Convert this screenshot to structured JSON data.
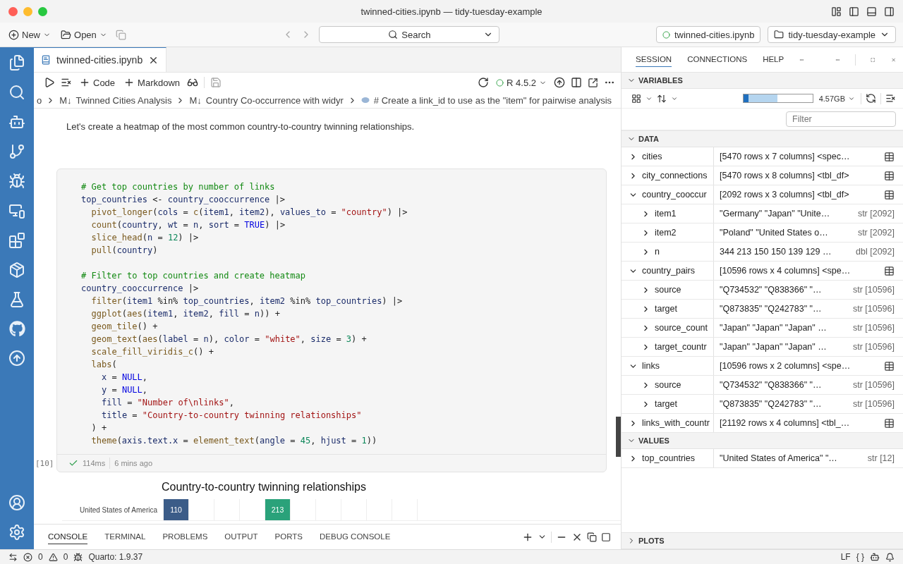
{
  "window": {
    "title": "twinned-cities.ipynb — tidy-tuesday-example"
  },
  "toolbar": {
    "new_label": "New",
    "open_label": "Open",
    "search_label": "Search",
    "file_pill": "twinned-cities.ipynb",
    "folder_pill": "tidy-tuesday-example"
  },
  "editor_tabs": [
    {
      "label": "twinned-cities.ipynb",
      "selected": true
    }
  ],
  "notebook_toolbar": {
    "code_label": "Code",
    "markdown_label": "Markdown",
    "kernel": "R 4.5.2"
  },
  "breadcrumbs": [
    {
      "kind": "plain",
      "text": "o"
    },
    {
      "kind": "markdown",
      "marker": "M↓",
      "text": "Twinned Cities Analysis"
    },
    {
      "kind": "markdown",
      "marker": "M↓",
      "text": "Country Co-occurrence with widyr"
    },
    {
      "kind": "code",
      "text": "# Create a link_id to use as the \"item\" for pairwise analysis"
    }
  ],
  "markdown_text": "Let's create a heatmap of the most common country-to-country twinning relationships.",
  "code_cell": {
    "execution_count": "[10]",
    "success": true,
    "duration": "114ms",
    "ago": "6 mins ago",
    "lines": [
      {
        "kind": "root",
        "tokens": [
          {
            "kind": "comment",
            "text": "# Get top countries by number of links"
          }
        ]
      },
      {
        "kind": "root",
        "tokens": [
          {
            "kind": "var",
            "text": "top_countries"
          },
          {
            "kind": "op",
            "text": " <- "
          },
          {
            "kind": "var",
            "text": "country_cooccurrence"
          },
          {
            "kind": "op",
            "text": " |>"
          }
        ]
      },
      {
        "kind": "step",
        "tokens": [
          {
            "kind": "func",
            "text": "pivot_longer"
          },
          {
            "kind": "op",
            "text": "("
          },
          {
            "kind": "var",
            "text": "cols"
          },
          {
            "kind": "op",
            "text": " = "
          },
          {
            "kind": "func",
            "text": "c"
          },
          {
            "kind": "op",
            "text": "("
          },
          {
            "kind": "var",
            "text": "item1"
          },
          {
            "kind": "op",
            "text": ", "
          },
          {
            "kind": "var",
            "text": "item2"
          },
          {
            "kind": "op",
            "text": "), "
          },
          {
            "kind": "var",
            "text": "values_to"
          },
          {
            "kind": "op",
            "text": " = "
          },
          {
            "kind": "string",
            "text": "\"country\""
          },
          {
            "kind": "op",
            "text": ") |>"
          }
        ]
      },
      {
        "kind": "step",
        "tokens": [
          {
            "kind": "func",
            "text": "count"
          },
          {
            "kind": "op",
            "text": "("
          },
          {
            "kind": "var",
            "text": "country"
          },
          {
            "kind": "op",
            "text": ", "
          },
          {
            "kind": "var",
            "text": "wt"
          },
          {
            "kind": "op",
            "text": " = "
          },
          {
            "kind": "var",
            "text": "n"
          },
          {
            "kind": "op",
            "text": ", "
          },
          {
            "kind": "var",
            "text": "sort"
          },
          {
            "kind": "op",
            "text": " = "
          },
          {
            "kind": "keyword",
            "text": "TRUE"
          },
          {
            "kind": "op",
            "text": ") |>"
          }
        ]
      },
      {
        "kind": "step",
        "tokens": [
          {
            "kind": "func",
            "text": "slice_head"
          },
          {
            "kind": "op",
            "text": "("
          },
          {
            "kind": "var",
            "text": "n"
          },
          {
            "kind": "op",
            "text": " = "
          },
          {
            "kind": "number",
            "text": "12"
          },
          {
            "kind": "op",
            "text": ") |>"
          }
        ]
      },
      {
        "kind": "step",
        "tokens": [
          {
            "kind": "func",
            "text": "pull"
          },
          {
            "kind": "op",
            "text": "("
          },
          {
            "kind": "var",
            "text": "country"
          },
          {
            "kind": "op",
            "text": ")"
          }
        ]
      },
      {
        "kind": "blank"
      },
      {
        "kind": "root",
        "tokens": [
          {
            "kind": "comment",
            "text": "# Filter to top countries and create heatmap"
          }
        ]
      },
      {
        "kind": "root",
        "tokens": [
          {
            "kind": "var",
            "text": "country_cooccurrence"
          },
          {
            "kind": "op",
            "text": " |>"
          }
        ]
      },
      {
        "kind": "step",
        "tokens": [
          {
            "kind": "func",
            "text": "filter"
          },
          {
            "kind": "op",
            "text": "("
          },
          {
            "kind": "var",
            "text": "item1"
          },
          {
            "kind": "op",
            "text": " %in% "
          },
          {
            "kind": "var",
            "text": "top_countries"
          },
          {
            "kind": "op",
            "text": ", "
          },
          {
            "kind": "var",
            "text": "item2"
          },
          {
            "kind": "op",
            "text": " %in% "
          },
          {
            "kind": "var",
            "text": "top_countries"
          },
          {
            "kind": "op",
            "text": ") |>"
          }
        ]
      },
      {
        "kind": "step",
        "tokens": [
          {
            "kind": "func",
            "text": "ggplot"
          },
          {
            "kind": "op",
            "text": "("
          },
          {
            "kind": "func",
            "text": "aes"
          },
          {
            "kind": "op",
            "text": "("
          },
          {
            "kind": "var",
            "text": "item1"
          },
          {
            "kind": "op",
            "text": ", "
          },
          {
            "kind": "var",
            "text": "item2"
          },
          {
            "kind": "op",
            "text": ", "
          },
          {
            "kind": "var",
            "text": "fill"
          },
          {
            "kind": "op",
            "text": " = "
          },
          {
            "kind": "var",
            "text": "n"
          },
          {
            "kind": "op",
            "text": ")) +"
          }
        ]
      },
      {
        "kind": "step",
        "tokens": [
          {
            "kind": "func",
            "text": "geom_tile"
          },
          {
            "kind": "op",
            "text": "() +"
          }
        ]
      },
      {
        "kind": "step",
        "tokens": [
          {
            "kind": "func",
            "text": "geom_text"
          },
          {
            "kind": "op",
            "text": "("
          },
          {
            "kind": "func",
            "text": "aes"
          },
          {
            "kind": "op",
            "text": "("
          },
          {
            "kind": "var",
            "text": "label"
          },
          {
            "kind": "op",
            "text": " = "
          },
          {
            "kind": "var",
            "text": "n"
          },
          {
            "kind": "op",
            "text": "), "
          },
          {
            "kind": "var",
            "text": "color"
          },
          {
            "kind": "op",
            "text": " = "
          },
          {
            "kind": "string",
            "text": "\"white\""
          },
          {
            "kind": "op",
            "text": ", "
          },
          {
            "kind": "var",
            "text": "size"
          },
          {
            "kind": "op",
            "text": " = "
          },
          {
            "kind": "number",
            "text": "3"
          },
          {
            "kind": "op",
            "text": ") +"
          }
        ]
      },
      {
        "kind": "step",
        "tokens": [
          {
            "kind": "func",
            "text": "scale_fill_viridis_c"
          },
          {
            "kind": "op",
            "text": "() +"
          }
        ]
      },
      {
        "kind": "step",
        "tokens": [
          {
            "kind": "func",
            "text": "labs"
          },
          {
            "kind": "op",
            "text": "("
          }
        ]
      },
      {
        "kind": "arg",
        "tokens": [
          {
            "kind": "var",
            "text": "x"
          },
          {
            "kind": "op",
            "text": " = "
          },
          {
            "kind": "keyword",
            "text": "NULL"
          },
          {
            "kind": "op",
            "text": ","
          }
        ]
      },
      {
        "kind": "arg",
        "tokens": [
          {
            "kind": "var",
            "text": "y"
          },
          {
            "kind": "op",
            "text": " = "
          },
          {
            "kind": "keyword",
            "text": "NULL"
          },
          {
            "kind": "op",
            "text": ","
          }
        ]
      },
      {
        "kind": "arg",
        "tokens": [
          {
            "kind": "var",
            "text": "fill"
          },
          {
            "kind": "op",
            "text": " = "
          },
          {
            "kind": "string",
            "text": "\"Number of\\nlinks\""
          },
          {
            "kind": "op",
            "text": ","
          }
        ]
      },
      {
        "kind": "arg",
        "tokens": [
          {
            "kind": "var",
            "text": "title"
          },
          {
            "kind": "op",
            "text": " = "
          },
          {
            "kind": "string",
            "text": "\"Country-to-country twinning relationships\""
          }
        ]
      },
      {
        "kind": "step",
        "tokens": [
          {
            "kind": "op",
            "text": ") +"
          }
        ]
      },
      {
        "kind": "step",
        "tokens": [
          {
            "kind": "func",
            "text": "theme"
          },
          {
            "kind": "op",
            "text": "("
          },
          {
            "kind": "var",
            "text": "axis.text.x"
          },
          {
            "kind": "op",
            "text": " = "
          },
          {
            "kind": "func",
            "text": "element_text"
          },
          {
            "kind": "op",
            "text": "("
          },
          {
            "kind": "var",
            "text": "angle"
          },
          {
            "kind": "op",
            "text": " = "
          },
          {
            "kind": "number",
            "text": "45"
          },
          {
            "kind": "op",
            "text": ", "
          },
          {
            "kind": "var",
            "text": "hjust"
          },
          {
            "kind": "op",
            "text": " = "
          },
          {
            "kind": "number",
            "text": "1"
          },
          {
            "kind": "op",
            "text": "))"
          }
        ]
      }
    ]
  },
  "output_chart": {
    "title": "Country-to-country twinning relationships",
    "rows": [
      {
        "label": "United States of America",
        "cells": [
          {
            "kind": "tile",
            "text": "110",
            "color": "#3b5c88"
          },
          {
            "kind": "empty"
          },
          {
            "kind": "empty"
          },
          {
            "kind": "empty"
          },
          {
            "kind": "tile",
            "text": "213",
            "color": "#2aa27a"
          },
          {
            "kind": "empty"
          },
          {
            "kind": "empty"
          },
          {
            "kind": "empty"
          },
          {
            "kind": "empty"
          },
          {
            "kind": "empty"
          },
          {
            "kind": "empty"
          }
        ]
      }
    ]
  },
  "bottom_panel": {
    "tabs": [
      {
        "label": "CONSOLE",
        "selected": true
      },
      {
        "label": "TERMINAL",
        "selected": false
      },
      {
        "label": "PROBLEMS",
        "selected": false
      },
      {
        "label": "OUTPUT",
        "selected": false
      },
      {
        "label": "PORTS",
        "selected": false
      },
      {
        "label": "DEBUG CONSOLE",
        "selected": false
      }
    ]
  },
  "side_panel": {
    "tabs": [
      {
        "label": "SESSION",
        "selected": true
      },
      {
        "label": "CONNECTIONS",
        "selected": false
      },
      {
        "label": "HELP",
        "selected": false
      }
    ],
    "variables_title": "VARIABLES",
    "variables_expanded": true,
    "memory": {
      "label": "4.57GB",
      "segments": [
        {
          "level": 0.49,
          "color": "#b5d5ef"
        },
        {
          "level": 0.07,
          "color": "#1f6fbf"
        }
      ]
    },
    "filter_placeholder": "Filter",
    "groups": [
      {
        "title": "DATA",
        "expanded": true,
        "rows": [
          {
            "name": "cities",
            "value": "[5470 rows x 7 columns] <spec…",
            "viewable": true,
            "expanded": false
          },
          {
            "name": "city_connections",
            "value": "[5470 rows x 8 columns] <tbl_df>",
            "viewable": true,
            "expanded": false
          },
          {
            "name": "country_cooccur",
            "value": "[2092 rows x 3 columns] <tbl_df>",
            "viewable": true,
            "expanded": true,
            "children": [
              {
                "name": "item1",
                "value": "\"Germany\" \"Japan\" \"Unite…",
                "type": "str [2092]",
                "expanded": false
              },
              {
                "name": "item2",
                "value": "\"Poland\" \"United States o…",
                "type": "str [2092]",
                "expanded": false
              },
              {
                "name": "n",
                "value": "344 213 150 150 139 129 …",
                "type": "dbl [2092]",
                "expanded": false
              }
            ]
          },
          {
            "name": "country_pairs",
            "value": "[10596 rows x 4 columns] <spe…",
            "viewable": true,
            "expanded": true,
            "children": [
              {
                "name": "source",
                "value": "\"Q734532\" \"Q838366\" \"…",
                "type": "str [10596]",
                "expanded": false
              },
              {
                "name": "target",
                "value": "\"Q873835\" \"Q242783\" \"…",
                "type": "str [10596]",
                "expanded": false
              },
              {
                "name": "source_count",
                "value": "\"Japan\" \"Japan\" \"Japan\" …",
                "type": "str [10596]",
                "expanded": false
              },
              {
                "name": "target_countr",
                "value": "\"Japan\" \"Japan\" \"Japan\" …",
                "type": "str [10596]",
                "expanded": false
              }
            ]
          },
          {
            "name": "links",
            "value": "[10596 rows x 2 columns] <spe…",
            "viewable": true,
            "expanded": true,
            "children": [
              {
                "name": "source",
                "value": "\"Q734532\" \"Q838366\" \"…",
                "type": "str [10596]",
                "expanded": false
              },
              {
                "name": "target",
                "value": "\"Q873835\" \"Q242783\" \"…",
                "type": "str [10596]",
                "expanded": false
              }
            ]
          },
          {
            "name": "links_with_countr",
            "value": "[21192 rows x 4 columns] <tbl_…",
            "viewable": true,
            "expanded": false
          }
        ]
      },
      {
        "title": "VALUES",
        "expanded": true,
        "rows": [
          {
            "name": "top_countries",
            "value": "\"United States of America\" \"…",
            "type": "str [12]",
            "expanded": false
          }
        ]
      }
    ],
    "plots_title": "PLOTS",
    "plots_expanded": false
  },
  "status_bar": {
    "errors": "0",
    "warnings": "0",
    "quarto": "Quarto: 1.9.37",
    "eol": "LF",
    "language": "{ }"
  }
}
